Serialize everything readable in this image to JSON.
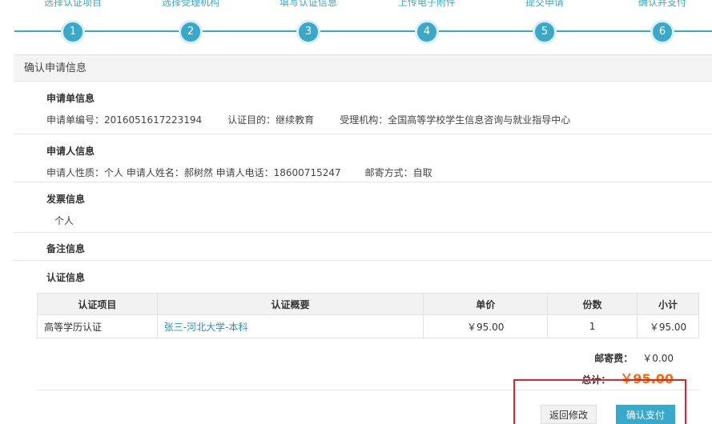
{
  "steps": [
    {
      "label": "选择认证项目",
      "num": "1"
    },
    {
      "label": "选择受理机构",
      "num": "2"
    },
    {
      "label": "填写认证信息",
      "num": "3"
    },
    {
      "label": "上传电子附件",
      "num": "4"
    },
    {
      "label": "提交申请",
      "num": "5"
    },
    {
      "label": "确认并支付",
      "num": "6"
    }
  ],
  "panel": {
    "title": "确认申请信息"
  },
  "application": {
    "title": "申请单信息",
    "number": "申请单编号：2016051617223194",
    "purpose": "认证目的：继续教育",
    "agency": "受理机构：全国高等学校学生信息咨询与就业指导中心"
  },
  "applicant": {
    "title": "申请人信息",
    "details": "申请人性质：个人  申请人姓名：郝树然  申请人电话：18600715247",
    "mailing": "邮寄方式：自取"
  },
  "invoice": {
    "title": "发票信息",
    "value": "个人"
  },
  "remarks": {
    "title": "备注信息"
  },
  "certification": {
    "title": "认证信息",
    "headers": [
      "认证项目",
      "认证概要",
      "单价",
      "份数",
      "小计"
    ],
    "rows": [
      {
        "item": "高等学历认证",
        "summary": "张三-河北大学-本科",
        "price": "￥95.00",
        "qty": "1",
        "subtotal": "￥95.00"
      }
    ],
    "postage_label": "邮寄费：",
    "postage_value": "￥0.00",
    "total_label": "总计：",
    "total_value": "￥95.00"
  },
  "actions": {
    "back_label": "返回修改",
    "pay_label": "确认支付"
  },
  "colors": {
    "accent": "#3aa8c9",
    "total": "#ff6a00",
    "highlight": "#d9262c",
    "link": "#2f8fbd"
  }
}
